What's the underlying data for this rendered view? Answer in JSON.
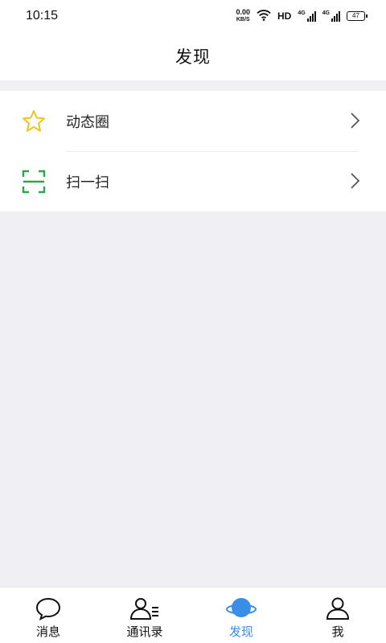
{
  "status_bar": {
    "time": "10:15",
    "net_speed_value": "0.00",
    "net_speed_unit": "KB/S",
    "hd": "HD",
    "signal1": "4G",
    "signal2": "4G",
    "battery": "47"
  },
  "header": {
    "title": "发现"
  },
  "menu": {
    "items": [
      {
        "label": "动态圈",
        "icon": "star-icon",
        "icon_color": "#f0c419"
      },
      {
        "label": "扫一扫",
        "icon": "scan-icon",
        "icon_color": "#2ea44f"
      }
    ]
  },
  "tabbar": {
    "active_color": "#3a8ee6",
    "tabs": [
      {
        "label": "消息",
        "icon": "chat-bubble-icon"
      },
      {
        "label": "通讯录",
        "icon": "contacts-icon"
      },
      {
        "label": "发现",
        "icon": "planet-icon",
        "active": true
      },
      {
        "label": "我",
        "icon": "person-icon"
      }
    ]
  }
}
